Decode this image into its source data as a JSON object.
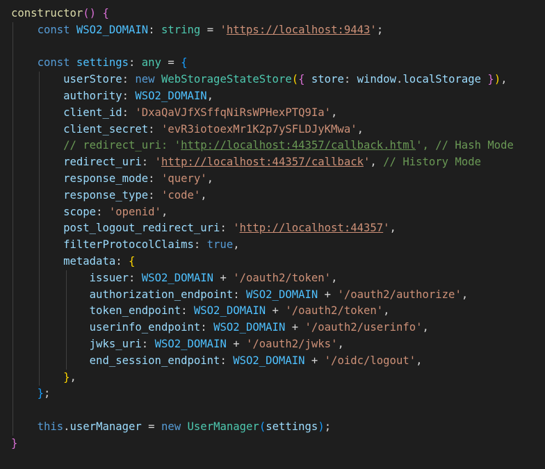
{
  "editor": {
    "lines": [
      [
        {
          "t": "constructor",
          "c": "fn"
        },
        {
          "t": "()",
          "c": "brk2"
        },
        {
          "t": " ",
          "c": "punc"
        },
        {
          "t": "{",
          "c": "brk2"
        }
      ],
      [
        {
          "t": "    ",
          "c": "punc"
        },
        {
          "t": "const",
          "c": "kw"
        },
        {
          "t": " ",
          "c": "punc"
        },
        {
          "t": "WSO2_DOMAIN",
          "c": "const"
        },
        {
          "t": ": ",
          "c": "punc"
        },
        {
          "t": "string",
          "c": "type"
        },
        {
          "t": " = ",
          "c": "punc"
        },
        {
          "t": "'",
          "c": "str"
        },
        {
          "t": "https://localhost:9443",
          "c": "str url"
        },
        {
          "t": "'",
          "c": "str"
        },
        {
          "t": ";",
          "c": "punc"
        }
      ],
      [],
      [
        {
          "t": "    ",
          "c": "punc"
        },
        {
          "t": "const",
          "c": "kw"
        },
        {
          "t": " ",
          "c": "punc"
        },
        {
          "t": "settings",
          "c": "const"
        },
        {
          "t": ": ",
          "c": "punc"
        },
        {
          "t": "any",
          "c": "type"
        },
        {
          "t": " = ",
          "c": "punc"
        },
        {
          "t": "{",
          "c": "brk3"
        }
      ],
      [
        {
          "t": "        ",
          "c": "punc"
        },
        {
          "t": "userStore",
          "c": "var"
        },
        {
          "t": ": ",
          "c": "punc"
        },
        {
          "t": "new",
          "c": "kw"
        },
        {
          "t": " ",
          "c": "punc"
        },
        {
          "t": "WebStorageStateStore",
          "c": "type"
        },
        {
          "t": "(",
          "c": "brk1"
        },
        {
          "t": "{",
          "c": "brk2"
        },
        {
          "t": " ",
          "c": "punc"
        },
        {
          "t": "store",
          "c": "var"
        },
        {
          "t": ": ",
          "c": "punc"
        },
        {
          "t": "window",
          "c": "var"
        },
        {
          "t": ".",
          "c": "punc"
        },
        {
          "t": "localStorage",
          "c": "var"
        },
        {
          "t": " ",
          "c": "punc"
        },
        {
          "t": "}",
          "c": "brk2"
        },
        {
          "t": ")",
          "c": "brk1"
        },
        {
          "t": ",",
          "c": "punc"
        }
      ],
      [
        {
          "t": "        ",
          "c": "punc"
        },
        {
          "t": "authority",
          "c": "var"
        },
        {
          "t": ": ",
          "c": "punc"
        },
        {
          "t": "WSO2_DOMAIN",
          "c": "const"
        },
        {
          "t": ",",
          "c": "punc"
        }
      ],
      [
        {
          "t": "        ",
          "c": "punc"
        },
        {
          "t": "client_id",
          "c": "var"
        },
        {
          "t": ": ",
          "c": "punc"
        },
        {
          "t": "'DxaQaVJfXSffqNiRsWPHexPTQ9Ia'",
          "c": "str"
        },
        {
          "t": ",",
          "c": "punc"
        }
      ],
      [
        {
          "t": "        ",
          "c": "punc"
        },
        {
          "t": "client_secret",
          "c": "var"
        },
        {
          "t": ": ",
          "c": "punc"
        },
        {
          "t": "'evR3iotoexMr1K2p7ySFLDJyKMwa'",
          "c": "str"
        },
        {
          "t": ",",
          "c": "punc"
        }
      ],
      [
        {
          "t": "        ",
          "c": "punc"
        },
        {
          "t": "// redirect_uri: '",
          "c": "cmt"
        },
        {
          "t": "http://localhost:44357/callback.html",
          "c": "cmt url"
        },
        {
          "t": "', // Hash Mode",
          "c": "cmt"
        }
      ],
      [
        {
          "t": "        ",
          "c": "punc"
        },
        {
          "t": "redirect_uri",
          "c": "var"
        },
        {
          "t": ": ",
          "c": "punc"
        },
        {
          "t": "'",
          "c": "str"
        },
        {
          "t": "http://localhost:44357/callback",
          "c": "str url"
        },
        {
          "t": "'",
          "c": "str"
        },
        {
          "t": ", ",
          "c": "punc"
        },
        {
          "t": "// History Mode",
          "c": "cmt"
        }
      ],
      [
        {
          "t": "        ",
          "c": "punc"
        },
        {
          "t": "response_mode",
          "c": "var"
        },
        {
          "t": ": ",
          "c": "punc"
        },
        {
          "t": "'query'",
          "c": "str"
        },
        {
          "t": ",",
          "c": "punc"
        }
      ],
      [
        {
          "t": "        ",
          "c": "punc"
        },
        {
          "t": "response_type",
          "c": "var"
        },
        {
          "t": ": ",
          "c": "punc"
        },
        {
          "t": "'code'",
          "c": "str"
        },
        {
          "t": ",",
          "c": "punc"
        }
      ],
      [
        {
          "t": "        ",
          "c": "punc"
        },
        {
          "t": "scope",
          "c": "var"
        },
        {
          "t": ": ",
          "c": "punc"
        },
        {
          "t": "'openid'",
          "c": "str"
        },
        {
          "t": ",",
          "c": "punc"
        }
      ],
      [
        {
          "t": "        ",
          "c": "punc"
        },
        {
          "t": "post_logout_redirect_uri",
          "c": "var"
        },
        {
          "t": ": ",
          "c": "punc"
        },
        {
          "t": "'",
          "c": "str"
        },
        {
          "t": "http://localhost:44357",
          "c": "str url"
        },
        {
          "t": "'",
          "c": "str"
        },
        {
          "t": ",",
          "c": "punc"
        }
      ],
      [
        {
          "t": "        ",
          "c": "punc"
        },
        {
          "t": "filterProtocolClaims",
          "c": "var"
        },
        {
          "t": ": ",
          "c": "punc"
        },
        {
          "t": "true",
          "c": "kw"
        },
        {
          "t": ",",
          "c": "punc"
        }
      ],
      [
        {
          "t": "        ",
          "c": "punc"
        },
        {
          "t": "metadata",
          "c": "var"
        },
        {
          "t": ": ",
          "c": "punc"
        },
        {
          "t": "{",
          "c": "brk1"
        }
      ],
      [
        {
          "t": "            ",
          "c": "punc"
        },
        {
          "t": "issuer",
          "c": "var"
        },
        {
          "t": ": ",
          "c": "punc"
        },
        {
          "t": "WSO2_DOMAIN",
          "c": "const"
        },
        {
          "t": " + ",
          "c": "punc"
        },
        {
          "t": "'/oauth2/token'",
          "c": "str"
        },
        {
          "t": ",",
          "c": "punc"
        }
      ],
      [
        {
          "t": "            ",
          "c": "punc"
        },
        {
          "t": "authorization_endpoint",
          "c": "var"
        },
        {
          "t": ": ",
          "c": "punc"
        },
        {
          "t": "WSO2_DOMAIN",
          "c": "const"
        },
        {
          "t": " + ",
          "c": "punc"
        },
        {
          "t": "'/oauth2/authorize'",
          "c": "str"
        },
        {
          "t": ",",
          "c": "punc"
        }
      ],
      [
        {
          "t": "            ",
          "c": "punc"
        },
        {
          "t": "token_endpoint",
          "c": "var"
        },
        {
          "t": ": ",
          "c": "punc"
        },
        {
          "t": "WSO2_DOMAIN",
          "c": "const"
        },
        {
          "t": " + ",
          "c": "punc"
        },
        {
          "t": "'/oauth2/token'",
          "c": "str"
        },
        {
          "t": ",",
          "c": "punc"
        }
      ],
      [
        {
          "t": "            ",
          "c": "punc"
        },
        {
          "t": "userinfo_endpoint",
          "c": "var"
        },
        {
          "t": ": ",
          "c": "punc"
        },
        {
          "t": "WSO2_DOMAIN",
          "c": "const"
        },
        {
          "t": " + ",
          "c": "punc"
        },
        {
          "t": "'/oauth2/userinfo'",
          "c": "str"
        },
        {
          "t": ",",
          "c": "punc"
        }
      ],
      [
        {
          "t": "            ",
          "c": "punc"
        },
        {
          "t": "jwks_uri",
          "c": "var"
        },
        {
          "t": ": ",
          "c": "punc"
        },
        {
          "t": "WSO2_DOMAIN",
          "c": "const"
        },
        {
          "t": " + ",
          "c": "punc"
        },
        {
          "t": "'/oauth2/jwks'",
          "c": "str"
        },
        {
          "t": ",",
          "c": "punc"
        }
      ],
      [
        {
          "t": "            ",
          "c": "punc"
        },
        {
          "t": "end_session_endpoint",
          "c": "var"
        },
        {
          "t": ": ",
          "c": "punc"
        },
        {
          "t": "WSO2_DOMAIN",
          "c": "const"
        },
        {
          "t": " + ",
          "c": "punc"
        },
        {
          "t": "'/oidc/logout'",
          "c": "str"
        },
        {
          "t": ",",
          "c": "punc"
        }
      ],
      [
        {
          "t": "        ",
          "c": "punc"
        },
        {
          "t": "}",
          "c": "brk1"
        },
        {
          "t": ",",
          "c": "punc"
        }
      ],
      [
        {
          "t": "    ",
          "c": "punc"
        },
        {
          "t": "}",
          "c": "brk3"
        },
        {
          "t": ";",
          "c": "punc"
        }
      ],
      [],
      [
        {
          "t": "    ",
          "c": "punc"
        },
        {
          "t": "this",
          "c": "kw"
        },
        {
          "t": ".",
          "c": "punc"
        },
        {
          "t": "userManager",
          "c": "var"
        },
        {
          "t": " = ",
          "c": "punc"
        },
        {
          "t": "new",
          "c": "kw"
        },
        {
          "t": " ",
          "c": "punc"
        },
        {
          "t": "UserManager",
          "c": "type"
        },
        {
          "t": "(",
          "c": "brk3"
        },
        {
          "t": "settings",
          "c": "var"
        },
        {
          "t": ")",
          "c": "brk3"
        },
        {
          "t": ";",
          "c": "punc"
        }
      ],
      [
        {
          "t": "}",
          "c": "brk2"
        }
      ]
    ],
    "indent_guides": [
      [],
      [
        1
      ],
      [
        1
      ],
      [
        1
      ],
      [
        1,
        2
      ],
      [
        1,
        2
      ],
      [
        1,
        2
      ],
      [
        1,
        2
      ],
      [
        1,
        2
      ],
      [
        1,
        2
      ],
      [
        1,
        2
      ],
      [
        1,
        2
      ],
      [
        1,
        2
      ],
      [
        1,
        2
      ],
      [
        1,
        2
      ],
      [
        1,
        2
      ],
      [
        1,
        2,
        3
      ],
      [
        1,
        2,
        3
      ],
      [
        1,
        2,
        3
      ],
      [
        1,
        2,
        3
      ],
      [
        1,
        2,
        3
      ],
      [
        1,
        2,
        3
      ],
      [
        1,
        2
      ],
      [
        1
      ],
      [
        1
      ],
      [
        1
      ],
      []
    ]
  }
}
